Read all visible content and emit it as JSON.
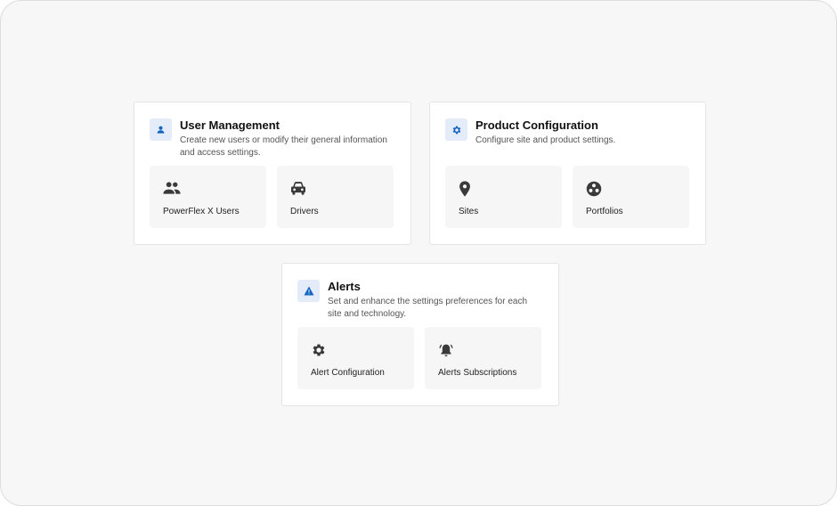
{
  "cards": {
    "user_management": {
      "title": "User Management",
      "description": "Create new users or modify their general information and access settings.",
      "icon": "person-icon",
      "tiles": [
        {
          "label": "PowerFlex X Users",
          "icon": "people-icon"
        },
        {
          "label": "Drivers",
          "icon": "car-icon"
        }
      ]
    },
    "product_configuration": {
      "title": "Product Configuration",
      "description": "Configure site and product settings.",
      "icon": "gear-icon",
      "tiles": [
        {
          "label": "Sites",
          "icon": "map-pin-icon"
        },
        {
          "label": "Portfolios",
          "icon": "portfolio-icon"
        }
      ]
    },
    "alerts": {
      "title": "Alerts",
      "description": "Set and enhance the settings preferences for each site and technology.",
      "icon": "warning-icon",
      "tiles": [
        {
          "label": "Alert Configuration",
          "icon": "gear-icon"
        },
        {
          "label": "Alerts Subscriptions",
          "icon": "alarm-bell-icon"
        }
      ]
    }
  },
  "colors": {
    "accent": "#1565c0",
    "icon_bg": "#e3ecf8",
    "tile_bg": "#f6f6f6",
    "tile_icon": "#3a3a3a"
  }
}
